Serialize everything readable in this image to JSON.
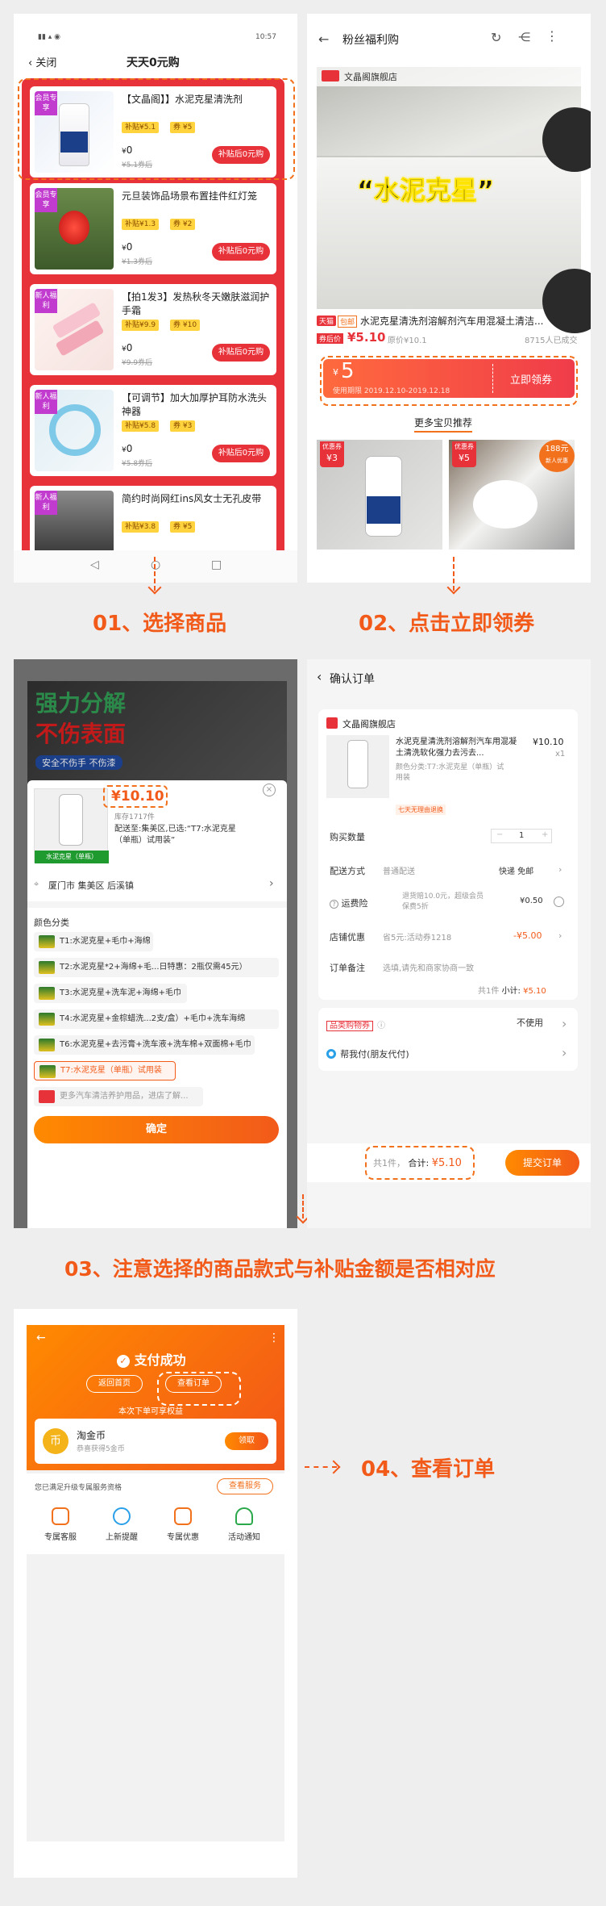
{
  "steps": {
    "s1": "01、选择商品",
    "s2": "02、点击立即领券",
    "s3": "03、注意选择的商品款式与补贴金额是否相对应",
    "s4": "04、查看订单"
  },
  "panel1": {
    "status": {
      "time": "10:57"
    },
    "nav": {
      "back": "关闭",
      "title": "天天0元购"
    },
    "cards": [
      {
        "ribbon": "会员专享",
        "title": "【文晶阁】】水泥克星清洗剂",
        "subsidy": "补贴¥5.1",
        "coupon": "券",
        "coupon_val": "¥5",
        "price": "0",
        "orig": "¥5.1券后",
        "btn": "补贴后0元购"
      },
      {
        "ribbon": "会员专享",
        "title": "元旦装饰品场景布置挂件红灯笼",
        "subsidy": "补贴¥1.3",
        "coupon": "券",
        "coupon_val": "¥2",
        "price": "0",
        "orig": "¥1.3券后",
        "btn": "补贴后0元购"
      },
      {
        "ribbon": "新人福利",
        "title": "【拍1发3】发热秋冬天嫩肤滋润护手霜",
        "subsidy": "补贴¥9.9",
        "coupon": "券",
        "coupon_val": "¥10",
        "price": "0",
        "orig": "¥9.9券后",
        "btn": "补贴后0元购"
      },
      {
        "ribbon": "新人福利",
        "title": "【可调节】加大加厚护耳防水洗头神器",
        "subsidy": "补贴¥5.8",
        "coupon": "券",
        "coupon_val": "¥3",
        "price": "0",
        "orig": "¥5.8券后",
        "btn": "补贴后0元购"
      },
      {
        "ribbon": "新人福利",
        "title": "简约时尚网红ins风女士无孔皮带",
        "subsidy": "补贴¥3.8",
        "coupon": "券",
        "coupon_val": "¥5",
        "price": "",
        "orig": "",
        "btn": ""
      }
    ]
  },
  "panel2": {
    "nav": {
      "title": "粉丝福利购"
    },
    "shop": "文晶阁旗舰店",
    "banner": "“水泥克星”",
    "tmall": "天猫",
    "tag_new": "包邮",
    "product_title": "水泥克星清洗剂溶解剂汽车用混凝土清洁...",
    "coupon_price_label": "券后价",
    "coupon_price": "¥5.10",
    "orig_price": "原价¥10.1",
    "sold": "8715人已成交",
    "coupon_amount": "5",
    "coupon_currency": "¥",
    "coupon_period": "使用期限 2019.12.10-2019.12.18",
    "coupon_btn": "立即领券",
    "more": "更多宝贝推荐",
    "rec1_tag": "优惠券",
    "rec1_val": "¥3",
    "rec2_tag": "优惠券",
    "rec2_val": "¥5",
    "rec2_badge": "188元",
    "rec2_badge_sub": "新人优惠"
  },
  "panel3": {
    "banner_top": "强力分解",
    "banner_bottom": "不伤表面",
    "banner_tag": "安全不伤手 不伤漆",
    "price": "¥10.10",
    "stock": "库存1717件",
    "ship_note": "配送至:集美区,已选:“T7:水泥克星（单瓶）试用装”",
    "thumb_tag": "水泥克星（单瓶）",
    "location": "厦门市 集美区 后溪镇",
    "section": "颜色分类",
    "options": [
      "T1:水泥克星+毛巾+海绵",
      "T2:水泥克星*2+海绵+毛...日特惠：2瓶仅需45元）",
      "T3:水泥克星+洗车泥+海绵+毛巾",
      "T4:水泥克星+金棕蜡洗...2支/盒）+毛巾+洗车海绵",
      "T6:水泥克星+去污膏+洗车液+洗车棉+双面棉+毛巾",
      "T7:水泥克星（单瓶）试用装",
      "更多汽车清洁养护用品，进店了解..."
    ],
    "confirm": "确定"
  },
  "panel4": {
    "nav": {
      "title": "确认订单"
    },
    "shop": "文晶阁旗舰店",
    "product_title": "水泥克星清洗剂溶解剂汽车用混凝土清洗软化强力去污去...",
    "product_price": "¥10.10",
    "product_qty": "x1",
    "product_spec": "颜色分类:T7:水泥克星（单瓶）试用装",
    "refund_tag": "七天无理由退换",
    "qty_label": "购买数量",
    "qty": "1",
    "ship_label": "配送方式",
    "ship_val": "普通配送",
    "ship_right": "快递 免邮",
    "insure_label": "运费险",
    "insure_val": "退货赔10.0元，超级会员保费5折",
    "insure_price": "¥0.50",
    "discount_label": "店铺优惠",
    "discount_val": "省5元:活动券1218",
    "discount_price": "-¥5.00",
    "note_label": "订单备注",
    "note_val": "选填,请先和商家协商一致",
    "subtotal_count": "共1件",
    "subtotal_label": "小计:",
    "subtotal": "¥5.10",
    "voucher_label": "品类购物券",
    "voucher_val": "不使用",
    "friend_pay": "帮我付(朋友代付)",
    "total_count": "共1件，",
    "total_label": "合计:",
    "total": "¥5.10",
    "submit": "提交订单"
  },
  "panel5": {
    "title": "支付成功",
    "home_btn": "返回首页",
    "order_btn": "查看订单",
    "benefit": "本次下单可享权益",
    "coin_title": "淘金币",
    "coin_sub": "恭喜获得5金币",
    "coin_btn": "领取",
    "service_title": "您已满足升级专属服务资格",
    "service_btn": "查看服务",
    "services": [
      "专属客服",
      "上新提醒",
      "专属优惠",
      "活动通知"
    ]
  }
}
